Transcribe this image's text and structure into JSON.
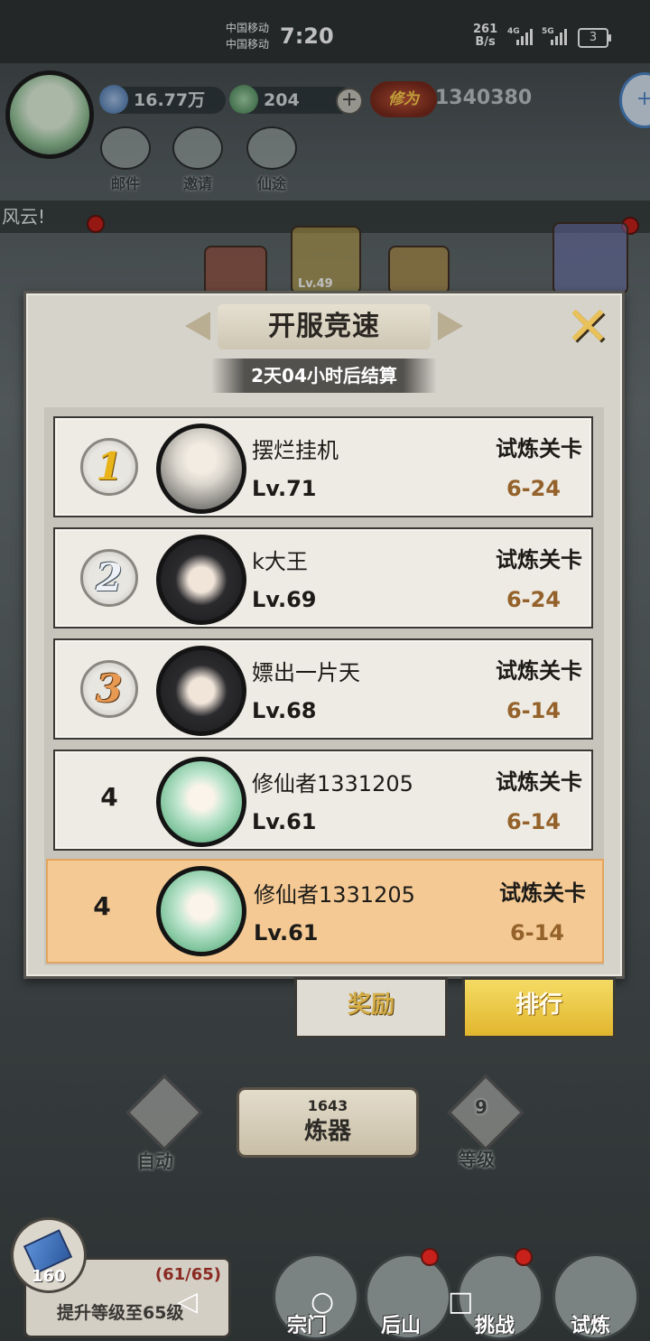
{
  "status_bar": {
    "carrier1": "中国移动",
    "carrier2": "中国移动",
    "time": "7:20",
    "net_speed_value": "261",
    "net_speed_unit": "B/s",
    "sig1_label": "4G",
    "sig2_label": "5G",
    "battery": "3"
  },
  "hud": {
    "spirit_stones": "16.77万",
    "jade": "204",
    "cultivation_badge": "修为",
    "cultivation_value": "1340380",
    "buttons": [
      {
        "label": "邮件"
      },
      {
        "label": "邀请"
      },
      {
        "label": "仙途"
      }
    ],
    "notice": "风云!",
    "bg_level": "Lv.49"
  },
  "modal": {
    "title": "开服竞速",
    "timer": "2天04小时后结算",
    "close_glyph": "✕",
    "entries": [
      {
        "rank": "1",
        "name": "摆烂挂机",
        "level": "Lv.71",
        "stage_label": "试炼关卡",
        "stage": "6-24",
        "avatar": "elder"
      },
      {
        "rank": "2",
        "name": "k大王",
        "level": "Lv.69",
        "stage_label": "试炼关卡",
        "stage": "6-24",
        "avatar": "black-hair"
      },
      {
        "rank": "3",
        "name": "嫖出一片天",
        "level": "Lv.68",
        "stage_label": "试炼关卡",
        "stage": "6-14",
        "avatar": "black-hair"
      },
      {
        "rank": "4",
        "name": "修仙者1331205",
        "level": "Lv.61",
        "stage_label": "试炼关卡",
        "stage": "6-14",
        "avatar": "green-hair"
      }
    ],
    "self_entry": {
      "rank": "4",
      "name": "修仙者1331205",
      "level": "Lv.61",
      "stage_label": "试炼关卡",
      "stage": "6-14",
      "avatar": "green-hair"
    }
  },
  "tabs": {
    "reward": "奖励",
    "ranking": "排行"
  },
  "forge": {
    "count": "1643",
    "label": "炼器",
    "auto_label": "自动",
    "level_value": "9",
    "level_label": "等级"
  },
  "bottom": {
    "gem_count": "160",
    "progress": "(61/65)",
    "upgrade_text": "提升等级至65级",
    "nav": [
      {
        "label": "宗门"
      },
      {
        "label": "后山"
      },
      {
        "label": "挑战"
      },
      {
        "label": "试炼"
      }
    ]
  },
  "colors": {
    "gold_stage": "#94622a",
    "self_row": "#f4c994",
    "rank_tab": "#e2b62e"
  },
  "icons": {
    "close": "close-icon",
    "plus": "plus-icon",
    "back": "back-icon",
    "home": "home-icon",
    "recents": "recents-icon"
  }
}
